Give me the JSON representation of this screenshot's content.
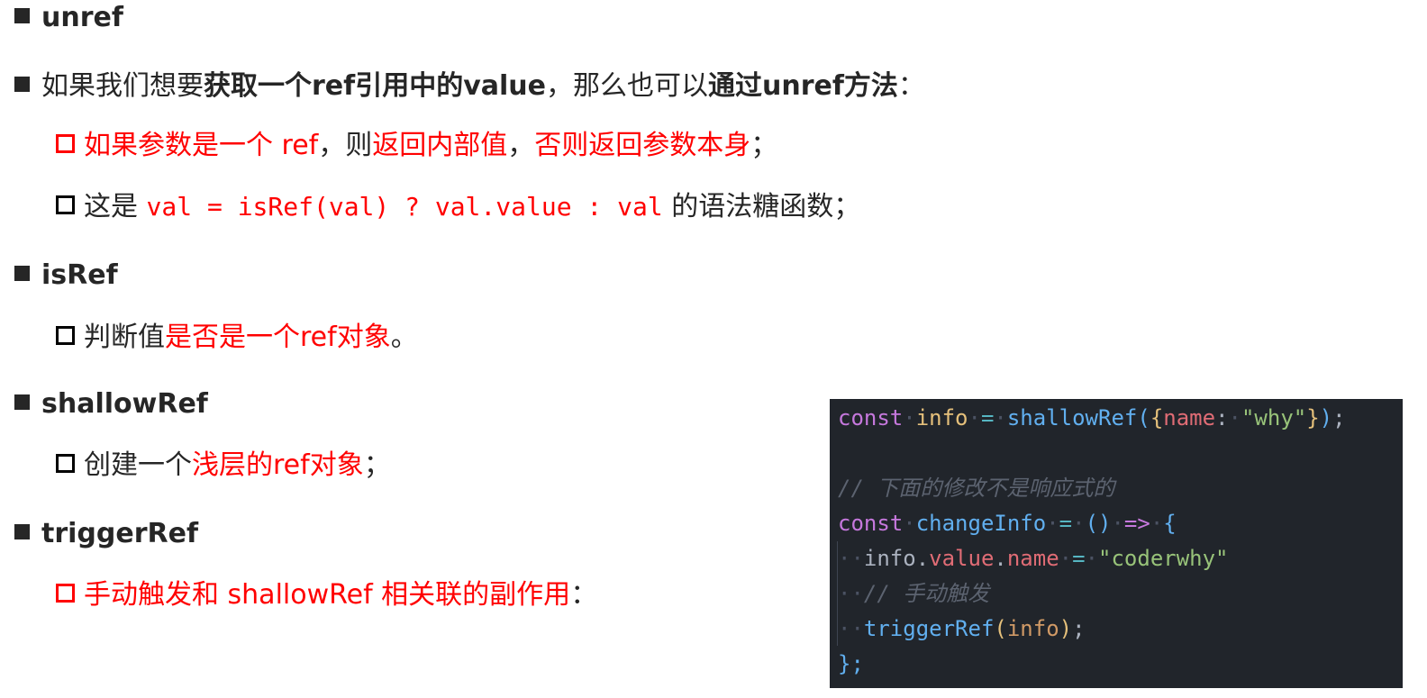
{
  "items": {
    "unref": {
      "title": "unref"
    },
    "desc": {
      "t1": "如果我们想要",
      "t2": "获取一个ref引用中的value",
      "t3": "，那么也可以",
      "t4": "通过unref方法",
      "t5": "："
    },
    "unref_sub1": {
      "t1": "如果参数是一个 ref",
      "t2": "，则",
      "t3": "返回内部值",
      "t4": "，",
      "t5": "否则返回参数本身",
      "t6": "；"
    },
    "unref_sub2": {
      "t1": "这是 ",
      "code": "val = isRef(val) ? val.value : val",
      "t2": " 的语法糖函数；"
    },
    "isref": {
      "title": "isRef"
    },
    "isref_sub1": {
      "t1": "判断值",
      "t2": "是否是一个ref对象",
      "t3": "。"
    },
    "shallowref": {
      "title": "shallowRef"
    },
    "shallowref_sub1": {
      "t1": "创建一个",
      "t2": "浅层的ref对象",
      "t3": "；"
    },
    "triggerref": {
      "title": "triggerRef"
    },
    "triggerref_sub1": {
      "t1": "手动触发和 shallowRef 相关联的副作用",
      "t2": "："
    }
  },
  "code": {
    "l1": {
      "kw": "const",
      "var": "info",
      "eq": "=",
      "fn": "shallowRef",
      "p1": "(",
      "b1": "{",
      "prop": "name",
      "colon": ":",
      "str": "\"why\"",
      "b2": "}",
      "p2": ")",
      "semi": ";"
    },
    "l3": {
      "comment": "// 下面的修改不是响应式的"
    },
    "l4": {
      "kw": "const",
      "fn": "changeInfo",
      "eq": "=",
      "parens": "()",
      "arrow": "=>",
      "brace": "{"
    },
    "l5": {
      "obj": "info",
      "dot1": ".",
      "prop1": "value",
      "dot2": ".",
      "prop2": "name",
      "eq": "=",
      "str": "\"coderwhy\""
    },
    "l6": {
      "comment": "// 手动触发"
    },
    "l7": {
      "fn": "triggerRef",
      "p1": "(",
      "arg": "info",
      "p2": ")",
      "semi": ";"
    },
    "l8": {
      "close": "};"
    }
  },
  "colors": {
    "accent_red": "#ff0000",
    "code_bg": "#21252b",
    "keyword": "#c678dd",
    "function": "#61afef",
    "string": "#98c379",
    "comment": "#5c6370"
  }
}
